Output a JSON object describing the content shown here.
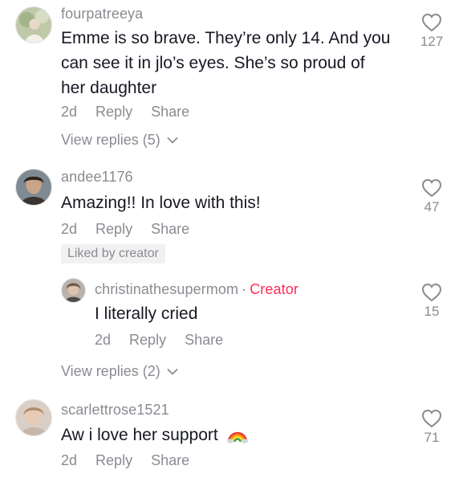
{
  "comments": [
    {
      "username": "fourpatreeya",
      "text_lines": [
        "Emme is so brave. They’re only 14. And you",
        "can see it in jlo’s eyes. She’s so proud of",
        "her daughter"
      ],
      "age": "2d",
      "reply_label": "Reply",
      "share_label": "Share",
      "likes": "127",
      "view_replies": "View replies (5)"
    },
    {
      "username": "andee1176",
      "text": "Amazing!! In love with this!",
      "age": "2d",
      "reply_label": "Reply",
      "share_label": "Share",
      "likes": "47",
      "liked_badge": "Liked by creator",
      "reply": {
        "username": "christinathesupermom",
        "separator": "·",
        "creator_badge": "Creator",
        "text": "I literally cried",
        "age": "2d",
        "reply_label": "Reply",
        "share_label": "Share",
        "likes": "15"
      },
      "view_replies": "View replies (2)"
    },
    {
      "username": "scarlettrose1521",
      "text": "Aw i love her support",
      "emoji": "rainbow-emoji",
      "age": "2d",
      "reply_label": "Reply",
      "share_label": "Share",
      "likes": "71"
    }
  ],
  "colors": {
    "text": "#161823",
    "muted": "#8a8b91",
    "creator": "#fe2c55",
    "badge_bg": "#f1f1f2"
  },
  "icons": {
    "like": "heart-outline-icon",
    "expand": "chevron-down-icon"
  }
}
